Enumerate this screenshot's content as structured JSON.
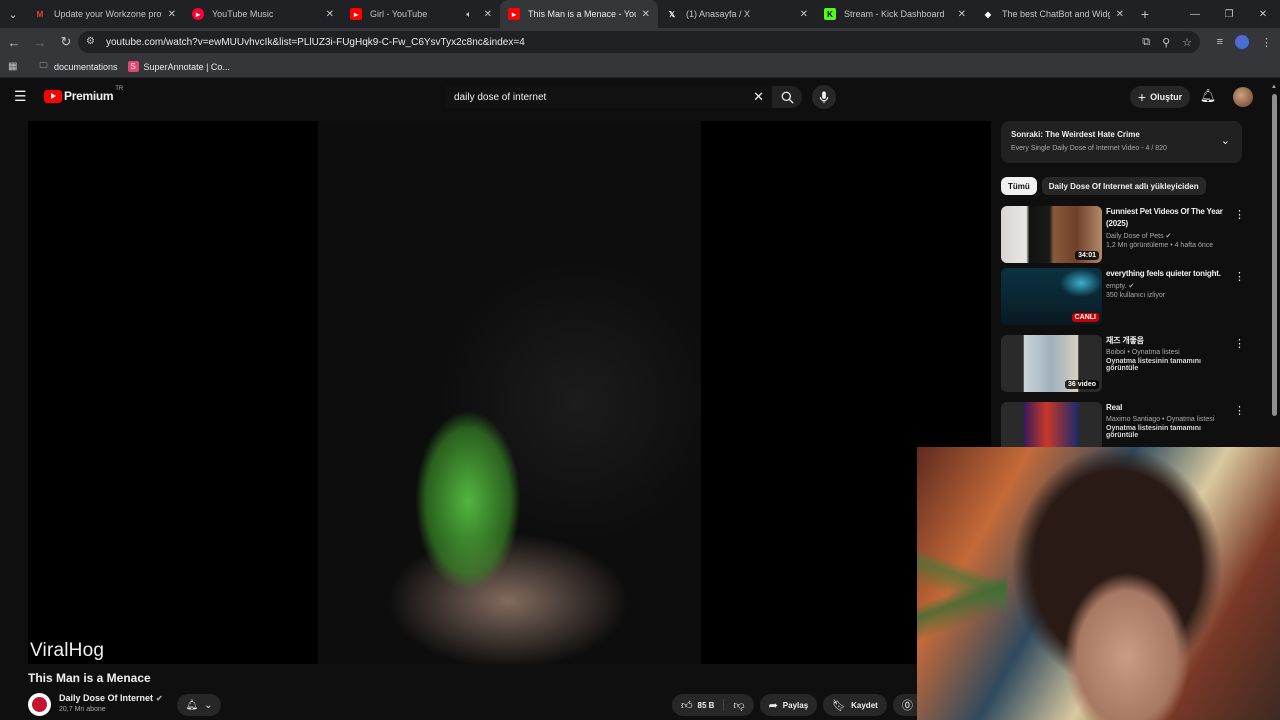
{
  "browser": {
    "tabs": [
      {
        "title": "Update your Workzone profile",
        "icon": "gmail-icon",
        "color": "#ea4335",
        "active": false
      },
      {
        "title": "YouTube Music",
        "icon": "youtube-music-icon",
        "color": "#ff0033",
        "active": false
      },
      {
        "title": "Girl - YouTube",
        "icon": "youtube-icon",
        "color": "#ff0000",
        "active": false,
        "muted": true
      },
      {
        "title": "This Man is a Menace - YouTub",
        "icon": "youtube-icon",
        "color": "#ff0000",
        "active": true
      },
      {
        "title": "(1) Anasayfa / X",
        "icon": "x-icon",
        "color": "#ffffff",
        "active": false
      },
      {
        "title": "Stream - Kick Dashboard",
        "icon": "kick-icon",
        "color": "#53fc18",
        "active": false
      },
      {
        "title": "The best ChatBot and Widgets",
        "icon": "chatbot-icon",
        "color": "#ffffff",
        "active": false
      }
    ],
    "url": "youtube.com/watch?v=ewMUUvhvcIk&list=PLlUZ3i-FUgHqk9-C-Fw_C6YsvTyx2c8nc&index=4",
    "bookmarks": [
      {
        "label": "documentations",
        "icon": "folder-icon"
      },
      {
        "label": "SuperAnnotate | Co...",
        "icon": "superannotate-icon"
      }
    ]
  },
  "youtube": {
    "logo_text": "Premium",
    "logo_region": "TR",
    "search_value": "daily dose of internet",
    "create_label": "Oluştur",
    "brand_color": "#ff0000"
  },
  "video": {
    "watermark": "ViralHog",
    "title": "This Man is a Menace",
    "channel": "Daily Dose Of Internet",
    "subscribers": "20,7 Mn abone",
    "likes": "85 B",
    "share_label": "Paylaş",
    "save_label": "Kaydet",
    "more_partial": "T"
  },
  "playlist": {
    "next_label": "Sonraki: The Weirdest Hate Crime",
    "sub_label": "Every Single Daily Dose of Internet Video - 4 / 820"
  },
  "chips": [
    "Tümü",
    "Daily Dose Of Internet adlı yükleyiciden"
  ],
  "recommendations": [
    {
      "title": "Funniest Pet Videos Of The Year (2025)",
      "channel": "Daily Dose of Pets",
      "meta": "1,2 Mn görüntüleme • 4 hafta önce",
      "badge": "34:01",
      "verified": true
    },
    {
      "title": "everything feels quieter tonight.",
      "channel": "empty.",
      "meta": "350 kullanıcı izliyor",
      "badge": "CANLI",
      "verified": true
    },
    {
      "title": "재즈 개좋음",
      "channel": "Boiboi • Oynatma listesi",
      "meta": "Oynatma listesinin tamamını görüntüle",
      "badge": "36 video",
      "verified": false
    },
    {
      "title": "Real",
      "channel": "Maximo Santiago • Oynatma listesi",
      "meta": "Oynatma listesinin tamamını görüntüle",
      "badge": "",
      "verified": false
    }
  ]
}
